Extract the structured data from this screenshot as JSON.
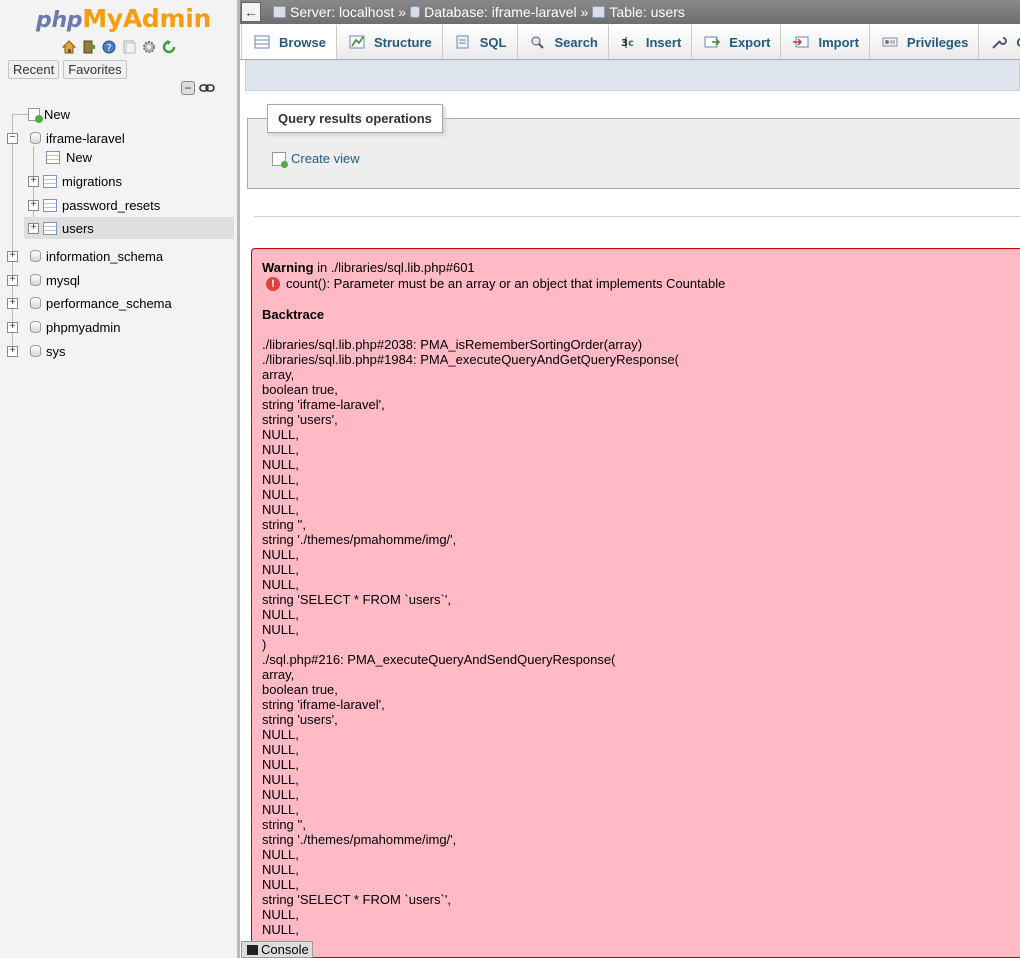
{
  "logo": {
    "part1": "php",
    "part2": "MyAdmin"
  },
  "quick_icons": [
    "home-icon",
    "logout-icon",
    "help-icon",
    "docs-icon",
    "settings-icon",
    "reload-icon"
  ],
  "recent_label": "Recent",
  "favorites_label": "Favorites",
  "tree": {
    "new_label": "New",
    "db_iframe": "iframe-laravel",
    "db_new": "New",
    "tables": [
      "migrations",
      "password_resets",
      "users"
    ],
    "other_dbs": [
      "information_schema",
      "mysql",
      "performance_schema",
      "phpmyadmin",
      "sys"
    ]
  },
  "breadcrumb": {
    "server": "Server: localhost",
    "database": "Database: iframe-laravel",
    "table": "Table: users",
    "separator": "»"
  },
  "tabs": [
    "Browse",
    "Structure",
    "SQL",
    "Search",
    "Insert",
    "Export",
    "Import",
    "Privileges",
    "O"
  ],
  "query_results": {
    "legend": "Query results operations",
    "create_view": "Create view"
  },
  "warning": {
    "label": "Warning",
    "location": " in ./libraries/sql.lib.php#601",
    "message": "count(): Parameter must be an array or an object that implements Countable",
    "backtrace_title": "Backtrace",
    "lines": [
      "./libraries/sql.lib.php#2038: PMA_isRememberSortingOrder(array)",
      "./libraries/sql.lib.php#1984: PMA_executeQueryAndGetQueryResponse(",
      "array,",
      "boolean true,",
      "string 'iframe-laravel',",
      "string 'users',",
      "NULL,",
      "NULL,",
      "NULL,",
      "NULL,",
      "NULL,",
      "NULL,",
      "string '',",
      "string './themes/pmahomme/img/',",
      "NULL,",
      "NULL,",
      "NULL,",
      "string 'SELECT * FROM `users`',",
      "NULL,",
      "NULL,",
      ")",
      "./sql.php#216: PMA_executeQueryAndSendQueryResponse(",
      "array,",
      "boolean true,",
      "string 'iframe-laravel',",
      "string 'users',",
      "NULL,",
      "NULL,",
      "NULL,",
      "NULL,",
      "NULL,",
      "NULL,",
      "string '',",
      "string './themes/pmahomme/img/',",
      "NULL,",
      "NULL,",
      "NULL,",
      "string 'SELECT * FROM `users`',",
      "NULL,",
      "NULL,"
    ]
  },
  "console_label": "Console",
  "colors": {
    "link": "#235a81",
    "warning_bg": "#ffbac5",
    "warning_border": "#cc0000",
    "logo_php": "#6c78af",
    "logo_myadmin": "#f89c0e"
  }
}
